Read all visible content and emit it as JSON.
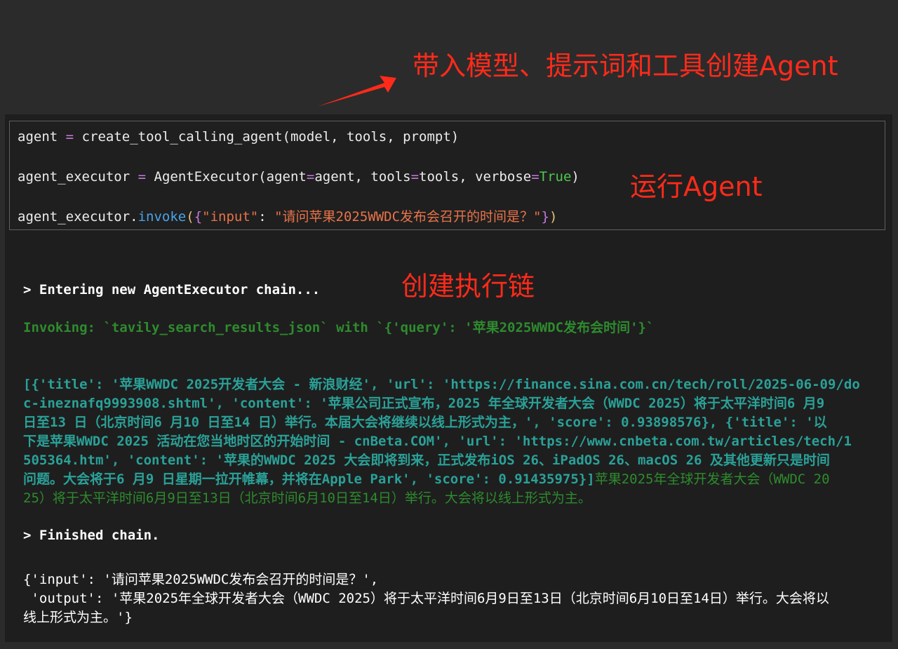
{
  "annotations": {
    "create_agent": "带入模型、提示词和工具创建Agent",
    "run_agent": "运行Agent",
    "create_chain": "创建执行链"
  },
  "code": {
    "line1": {
      "var": "agent",
      "op": "=",
      "call": "create_tool_calling_agent(model, tools, prompt)"
    },
    "line2": {
      "var": "agent_executor",
      "op": "=",
      "call_start": "AgentExecutor(agent",
      "arg1_val": "agent, tools",
      "arg2_val": "tools, verbose",
      "kw_true": "True",
      "close": ")"
    },
    "line3": {
      "obj": "agent_executor.",
      "method": "invoke",
      "open_paren": "(",
      "open_brace": "{",
      "key": "\"input\"",
      "colon": ": ",
      "value": "\"请问苹果2025WWDC发布会召开的时间是？\"",
      "close_brace": "}",
      "close_paren": ")"
    }
  },
  "output": {
    "entering": "> Entering new AgentExecutor chain...",
    "invoking": "Invoking: `tavily_search_results_json` with `{'query': '苹果2025WWDC发布会时间'}`",
    "result_lines": [
      "[{'title': '苹果WWDC 2025开发者大会 - 新浪财经', 'url': 'https://finance.sina.com.cn/tech/roll/2025-06-09/do",
      "c-ineznafq9993908.shtml', 'content': '苹果公司正式宣布，2025 年全球开发者大会（WWDC 2025）将于太平洋时间6 月9",
      "日至13 日（北京时间6 月10 日至14 日）举行。本届大会将继续以线上形式为主，', 'score': 0.93898576}, {'title': '以",
      "下是苹果WWDC 2025 活动在您当地时区的开始时间 - cnBeta.COM', 'url': 'https://www.cnbeta.com.tw/articles/tech/1",
      "505364.htm', 'content': '苹果的WWDC 2025 大会即将到来，正式发布iOS 26、iPadOS 26、macOS 26 及其他更新只是时间",
      "问题。大会将于6 月9 日星期一拉开帷幕，并将在Apple Park', 'score': 0.91435975}]"
    ],
    "result_tail_green": "苹果2025年全球开发者大会（WWDC 20",
    "green_line2": "25）将于太平洋时间6月9日至13日（北京时间6月10日至14日）举行。大会将以线上形式为主。",
    "finished": "> Finished chain.",
    "final_line1": "{'input': '请问苹果2025WWDC发布会召开的时间是？',",
    "final_line2": " 'output': '苹果2025年全球开发者大会（WWDC 2025）将于太平洋时间6月9日至13日（北京时间6月10日至14日）举行。大会将以",
    "final_line3": "线上形式为主。'}"
  },
  "colors": {
    "annotation": "#ff2a1a",
    "background": "#2b2b2b",
    "panel": "#1e1e1e"
  }
}
